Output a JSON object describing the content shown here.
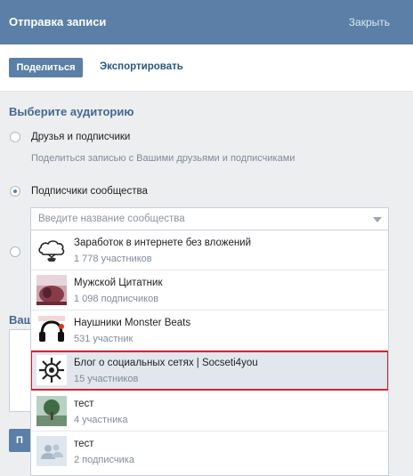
{
  "header": {
    "title": "Отправка записи",
    "close_label": "Закрыть"
  },
  "tabs": {
    "share_label": "Поделиться",
    "export_label": "Экспортировать"
  },
  "audience": {
    "title": "Выберите аудиторию",
    "options": [
      {
        "label": "Друзья и подписчики",
        "description": "Поделиться записью с Вашими друзьями и подписчиками",
        "checked": false
      },
      {
        "label": "Подписчики сообщества",
        "checked": true
      }
    ]
  },
  "community_search": {
    "placeholder": "Введите название сообщества"
  },
  "communities": [
    {
      "name": "Заработок в интернете без вложений",
      "count": "1 778 участников",
      "avatar": "cloud-hand-avatar"
    },
    {
      "name": "Мужской Цитатник",
      "count": "1 098 подписчиков",
      "avatar": "photo-avatar"
    },
    {
      "name": "Наушники Monster Beats",
      "count": "531 участник",
      "avatar": "headphones-avatar"
    },
    {
      "name": "Блог о социальных сетях | Socseti4you",
      "count": "15 участников",
      "avatar": "logo-avatar",
      "selected": true
    },
    {
      "name": "тест",
      "count": "4 участника",
      "avatar": "tree-avatar"
    },
    {
      "name": "тест",
      "count": "2 подписчика",
      "avatar": "default-group-avatar"
    }
  ],
  "behind": {
    "section_prefix": "Ваш",
    "send_prefix": "П"
  },
  "colors": {
    "header": "#5b7fa6",
    "highlight_border": "#d3282e",
    "selected_bg": "#e1e7ed"
  }
}
